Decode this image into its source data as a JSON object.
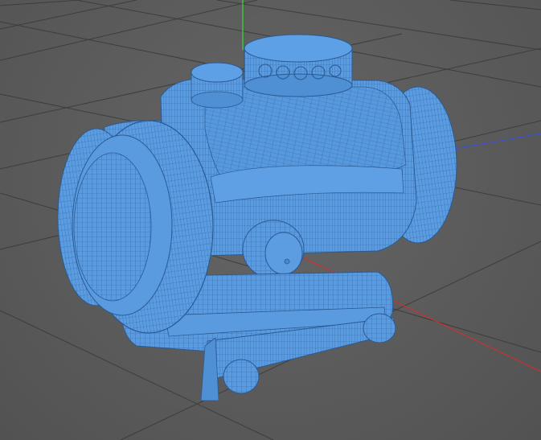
{
  "viewport": {
    "background_color": "#5b5b5b",
    "grid_color": "#3c3c3c",
    "axis_colors": {
      "x": "#c83232",
      "y": "#3cc83c",
      "z": "#3c50d2"
    },
    "mesh_fill_color": "#4d8fd6",
    "mesh_wire_color": "#2a5a94"
  },
  "scene": {
    "object": "red-dot-sight-wireframe",
    "display_mode": "wireframe-over-shaded"
  }
}
